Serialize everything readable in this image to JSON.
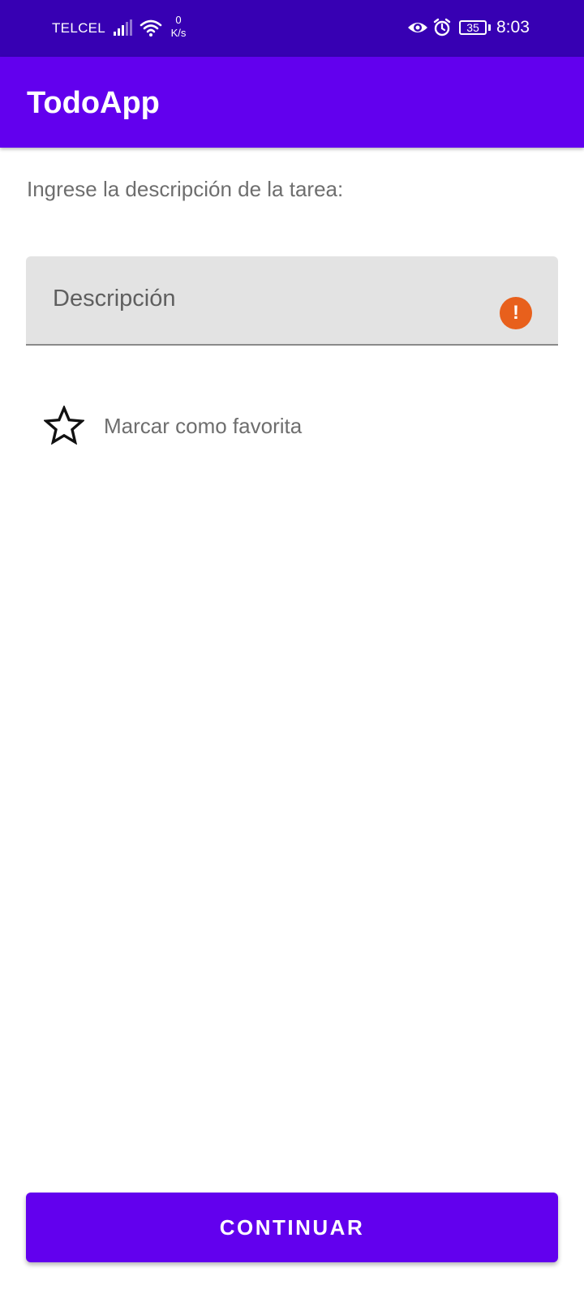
{
  "status_bar": {
    "carrier": "TELCEL",
    "net_speed_value": "0",
    "net_speed_unit": "K/s",
    "battery_level": "35",
    "time": "8:03",
    "icons": [
      "signal-icon",
      "wifi-icon",
      "eye-icon",
      "alarm-icon",
      "battery-icon"
    ]
  },
  "app_bar": {
    "title": "TodoApp"
  },
  "form": {
    "prompt": "Ingrese la descripción de la tarea:",
    "description_hint": "Descripción",
    "description_value": "",
    "error_icon_glyph": "!",
    "favorite_label": "Marcar como favorita",
    "favorite_checked": false
  },
  "actions": {
    "continue_label": "CONTINUAR"
  },
  "colors": {
    "status_bar": "#3700b3",
    "primary": "#6200ee",
    "error": "#e8601c",
    "field_background": "#e3e3e3"
  }
}
